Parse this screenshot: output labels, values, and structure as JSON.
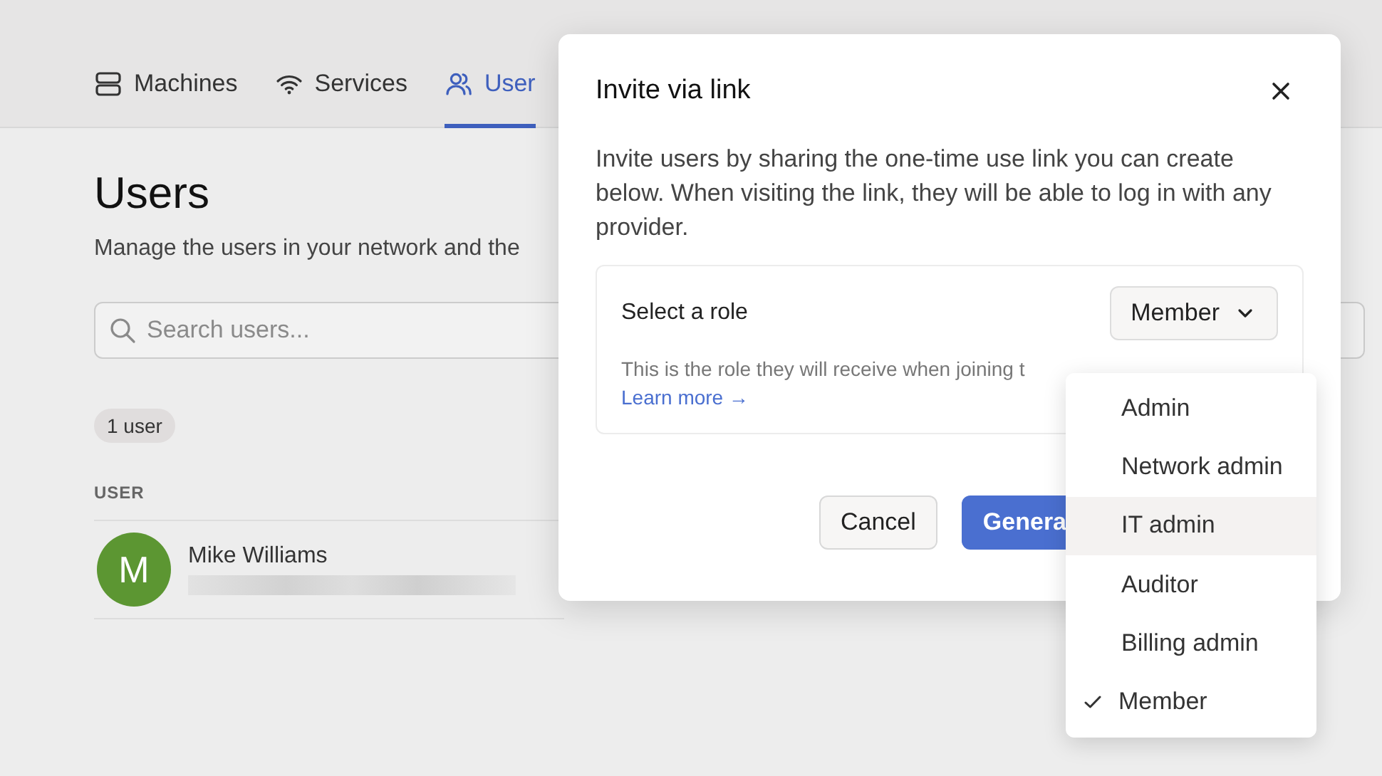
{
  "nav": {
    "tabs": [
      {
        "label": "Machines",
        "kind": "machines",
        "selected": false
      },
      {
        "label": "Services",
        "kind": "services",
        "selected": false
      },
      {
        "label": "User",
        "kind": "users",
        "selected": true
      }
    ]
  },
  "page": {
    "title": "Users",
    "description": "Manage the users in your network and the",
    "search": {
      "placeholder": "Search users..."
    },
    "count": "1 user",
    "table": {
      "columns": [
        "USER"
      ],
      "rows": [
        {
          "avatar": "M",
          "name": "Mike Williams"
        }
      ]
    }
  },
  "modal": {
    "title": "Invite via link",
    "body": "Invite users by sharing the one-time use link you can create below. When visiting the link, they will be able to log in with any provider.",
    "role": {
      "label": "Select a role",
      "value": "Member",
      "hint": "This is the role they will receive when joining t",
      "link": "Learn more →"
    },
    "buttons": [
      {
        "label": "Cancel",
        "kind": "secondary"
      },
      {
        "label": "Genera",
        "kind": "primary"
      }
    ]
  },
  "dropdown": {
    "options": [
      {
        "label": "Admin",
        "selected": false,
        "highlighted": false
      },
      {
        "label": "Network admin",
        "selected": false,
        "highlighted": false
      },
      {
        "label": "IT admin",
        "selected": false,
        "highlighted": true
      },
      {
        "label": "Auditor",
        "selected": false,
        "highlighted": false
      },
      {
        "label": "Billing admin",
        "selected": false,
        "highlighted": false
      },
      {
        "label": "Member",
        "selected": true,
        "highlighted": false
      }
    ]
  }
}
